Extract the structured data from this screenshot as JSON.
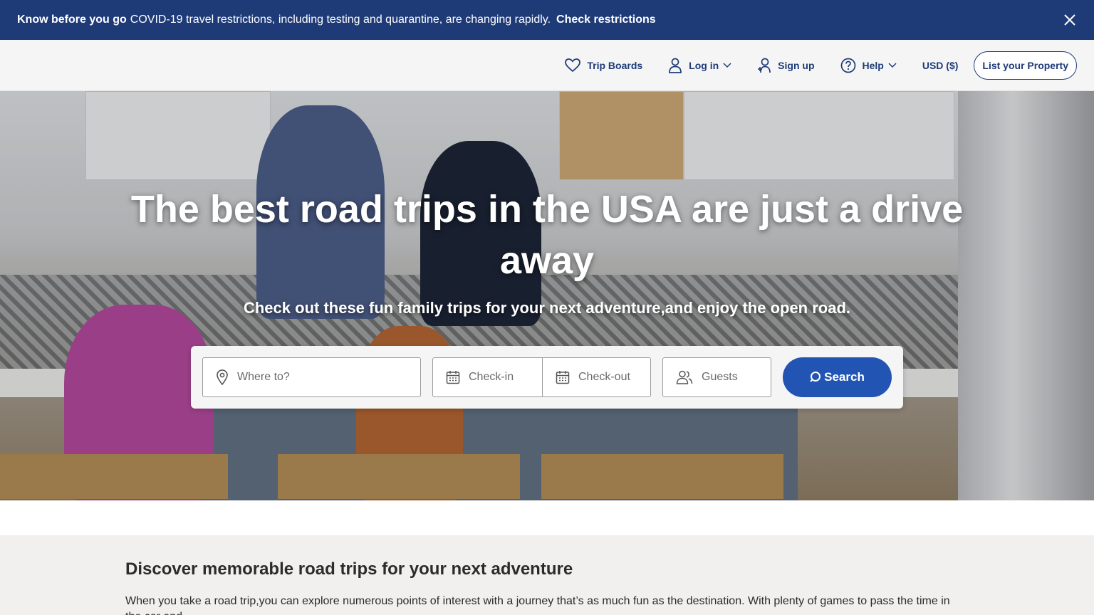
{
  "banner": {
    "strong": "Know before you go",
    "text": "COVID-19 travel restrictions, including testing and quarantine, are changing rapidly.",
    "link": "Check restrictions"
  },
  "nav": {
    "trip_boards": "Trip Boards",
    "log_in": "Log in",
    "sign_up": "Sign up",
    "help": "Help",
    "currency": "USD ($)",
    "list_property": "List your Property"
  },
  "hero": {
    "title": "The best road trips in the USA are just a drive away",
    "subtitle": "Check out these fun family trips for your next adventure,and enjoy the open road."
  },
  "search": {
    "where_placeholder": "Where to?",
    "checkin_placeholder": "Check-in",
    "checkout_placeholder": "Check-out",
    "guests_placeholder": "Guests",
    "button": "Search"
  },
  "content": {
    "heading": "Discover memorable road trips for your next adventure",
    "intro": "When you take a road trip,you can explore numerous points of interest with a journey that’s as much fun as the destination. With plenty of games to pass the time in the car and..."
  },
  "colors": {
    "brand_navy": "#1e3b78",
    "search_blue": "#2255b3"
  }
}
